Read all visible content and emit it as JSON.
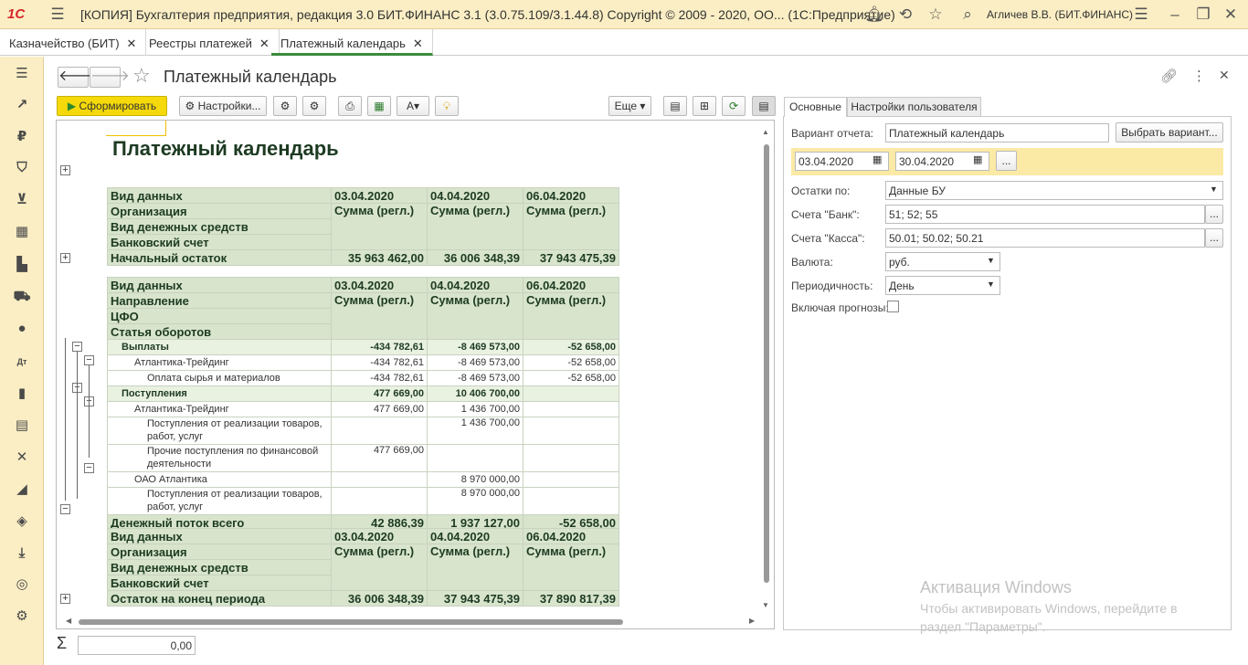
{
  "titlebar": {
    "logo": "1С",
    "title": "[КОПИЯ] Бухгалтерия предприятия, редакция 3.0  БИТ.ФИНАНС 3.1 (3.0.75.109/3.1.44.8) Copyright © 2009 - 2020, ОО...  (1С:Предприятие)",
    "user": "Агличев В.В. (БИТ.ФИНАНС)"
  },
  "tabs": [
    {
      "label": "Казначейство (БИТ)"
    },
    {
      "label": "Реестры платежей"
    },
    {
      "label": "Платежный календарь"
    }
  ],
  "form": {
    "title": "Платежный календарь"
  },
  "toolbar": {
    "generate": "Сформировать",
    "settings": "Настройки...",
    "more": "Еще"
  },
  "right_panel": {
    "tabs": [
      "Основные",
      "Настройки пользователя"
    ],
    "variant_label": "Вариант отчета:",
    "variant_value": "Платежный календарь",
    "choose_variant": "Выбрать вариант...",
    "date_from": "03.04.2020",
    "date_to": "30.04.2020",
    "ellipsis": "...",
    "balance_label": "Остатки по:",
    "balance_value": "Данные БУ",
    "bank_label": "Счета \"Банк\":",
    "bank_value": "51; 52; 55",
    "cash_label": "Счета \"Касса\":",
    "cash_value": "50.01; 50.02; 50.21",
    "currency_label": "Валюта:",
    "currency_value": "руб.",
    "period_label": "Периодичность:",
    "period_value": "День",
    "forecast_label": "Включая прогнозы:"
  },
  "report": {
    "title": "Платежный календарь",
    "col_dates": [
      "03.04.2020",
      "04.04.2020",
      "06.04.2020"
    ],
    "col_sub": "Сумма (регл.)",
    "block1": {
      "rows": [
        "Вид данных",
        "Организация",
        "Вид денежных средств",
        "Банковский счет"
      ],
      "total_label": "Начальный остаток",
      "totals": [
        "35 963 462,00",
        "36 006 348,39",
        "37 943 475,39"
      ]
    },
    "block2": {
      "rows": [
        "Вид данных",
        "Направление",
        "ЦФО",
        "Статья оборотов"
      ],
      "lines": [
        {
          "label": "Выплаты",
          "v": [
            "-434 782,61",
            "-8 469 573,00",
            "-52 658,00"
          ]
        },
        {
          "label": "Атлантика-Трейдинг",
          "v": [
            "-434 782,61",
            "-8 469 573,00",
            "-52 658,00"
          ]
        },
        {
          "label": "Оплата сырья и материалов",
          "v": [
            "-434 782,61",
            "-8 469 573,00",
            "-52 658,00"
          ]
        },
        {
          "label": "Поступления",
          "v": [
            "477 669,00",
            "10 406 700,00",
            ""
          ]
        },
        {
          "label": "Атлантика-Трейдинг",
          "v": [
            "477 669,00",
            "1 436 700,00",
            ""
          ]
        },
        {
          "label": "Поступления от реализации товаров, работ, услуг",
          "l1": "Поступления от реализации товаров,",
          "l2": "работ, услуг",
          "v": [
            "",
            "1 436 700,00",
            ""
          ]
        },
        {
          "label": "Прочие поступления по финансовой деятельности",
          "l1": "Прочие поступления по финансовой",
          "l2": "деятельности",
          "v": [
            "477 669,00",
            "",
            ""
          ]
        },
        {
          "label": "ОАО Атлантика",
          "v": [
            "",
            "8 970 000,00",
            ""
          ]
        },
        {
          "label": "Поступления от реализации товаров, работ, услуг",
          "l1": "Поступления от реализации товаров,",
          "l2": "работ, услуг",
          "v": [
            "",
            "8 970 000,00",
            ""
          ]
        }
      ],
      "total_label": "Денежный поток всего",
      "totals": [
        "42 886,39",
        "1 937 127,00",
        "-52 658,00"
      ]
    },
    "block3": {
      "rows": [
        "Вид данных",
        "Организация",
        "Вид денежных средств",
        "Банковский счет"
      ],
      "total_label": "Остаток на конец периода",
      "totals": [
        "36 006 348,39",
        "37 943 475,39",
        "37 890 817,39"
      ]
    }
  },
  "footer": {
    "sigma": "Σ",
    "sum_value": "0,00"
  },
  "watermark": {
    "line1": "Активация Windows",
    "line2": "Чтобы активировать Windows, перейдите в",
    "line3": "раздел \"Параметры\"."
  },
  "colors": {
    "topbar": "#fbeec4",
    "generate_button": "#f5d90a",
    "report_header": "#d8e4cc"
  }
}
